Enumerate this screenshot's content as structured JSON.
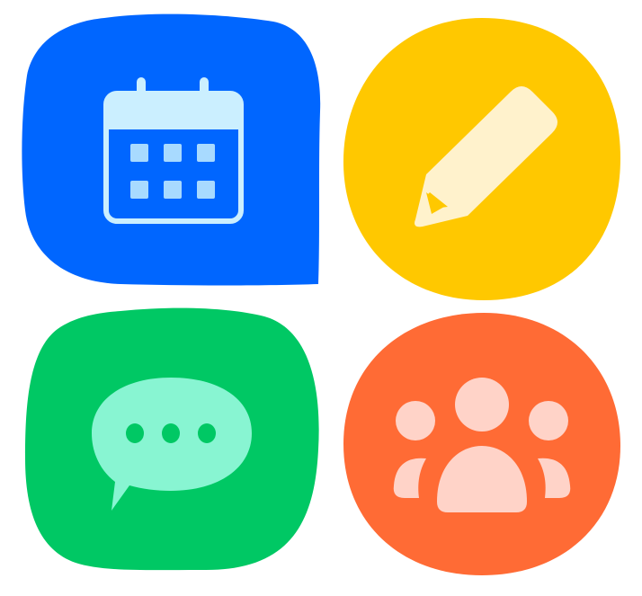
{
  "colors": {
    "calendar_bg": "#0066FF",
    "calendar_fg": "#CBEFFF",
    "calendar_cells": "#A8DAFF",
    "edit_bg": "#FFC800",
    "edit_fg": "#FFF2CC",
    "edit_tip": "#FFC800",
    "messages_bg": "#00C864",
    "messages_fg": "#88F5D2",
    "messages_dots": "#00C864",
    "people_bg": "#FF6B35",
    "people_fg": "#FFD3C8"
  },
  "icons": [
    {
      "id": "calendar",
      "icon": "calendar-icon"
    },
    {
      "id": "edit",
      "icon": "pencil-icon"
    },
    {
      "id": "messages",
      "icon": "chat-bubble-icon"
    },
    {
      "id": "people",
      "icon": "group-icon"
    }
  ]
}
